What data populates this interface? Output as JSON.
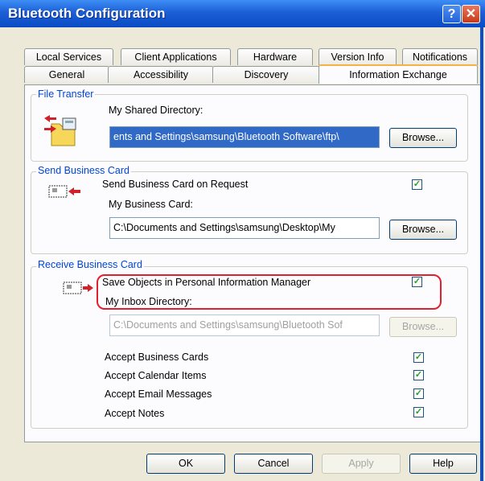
{
  "window": {
    "title": "Bluetooth Configuration"
  },
  "tabs_row1": [
    "Local Services",
    "Client Applications",
    "Hardware",
    "Version Info",
    "Notifications"
  ],
  "tabs_row2": [
    "General",
    "Accessibility",
    "Discovery",
    "Information Exchange"
  ],
  "file_transfer": {
    "group_label": "File Transfer",
    "dir_label": "My Shared Directory:",
    "dir_value": "ents and Settings\\samsung\\Bluetooth Software\\ftp\\",
    "browse": "Browse..."
  },
  "send_card": {
    "group_label": "Send Business Card",
    "on_request": "Send Business Card on Request",
    "on_request_checked": true,
    "card_label": "My Business Card:",
    "card_value": "C:\\Documents and Settings\\samsung\\Desktop\\My",
    "browse": "Browse..."
  },
  "receive_card": {
    "group_label": "Receive Business Card",
    "save_pim": "Save Objects in Personal Information Manager",
    "save_pim_checked": true,
    "inbox_label": "My Inbox Directory:",
    "inbox_value": "C:\\Documents and Settings\\samsung\\Bluetooth Sof",
    "browse": "Browse...",
    "accept": [
      {
        "label": "Accept Business Cards",
        "checked": true
      },
      {
        "label": "Accept Calendar Items",
        "checked": true
      },
      {
        "label": "Accept Email Messages",
        "checked": true
      },
      {
        "label": "Accept Notes",
        "checked": true
      }
    ]
  },
  "buttons": {
    "ok": "OK",
    "cancel": "Cancel",
    "apply": "Apply",
    "help": "Help"
  }
}
